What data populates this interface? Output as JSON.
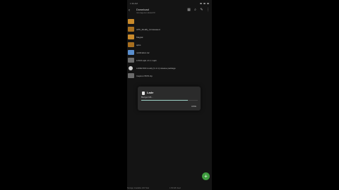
{
  "status": {
    "time": "1:39 AM"
  },
  "appbar": {
    "title": "Download",
    "subtitle": "/storage/emulated/0"
  },
  "toolbar": {
    "icons": [
      "grid-icon",
      "search-icon",
      "edit-icon",
      "more-icon"
    ]
  },
  "files": [
    {
      "name": "",
      "icon": "folder",
      "meta": ""
    },
    {
      "name": "APK_Modify_Unreleased",
      "icon": "folder-dark",
      "meta": ""
    },
    {
      "name": "Magisk",
      "icon": "folder",
      "meta": ""
    },
    {
      "name": "apks",
      "icon": "folder-dark",
      "meta": ""
    },
    {
      "name": "notification.tar",
      "icon": "file-blue",
      "meta": ""
    },
    {
      "name": "LOGS apk v1.1.1.apk",
      "icon": "file-grey",
      "meta": ""
    },
    {
      "name": "LADE FIM mostly (1.1.1) release package",
      "icon": "file-round",
      "meta": ""
    },
    {
      "name": "Inspiron 5570.zip",
      "icon": "file-grey",
      "meta": ""
    }
  ],
  "dialog": {
    "title": "Lade",
    "message": "Beriget Mit...",
    "button": "HIDE",
    "progress": 0.82
  },
  "fab": {
    "label": "+"
  },
  "footer": {
    "left": "Storage: Available 100 Total",
    "right": "1.53 GB Used"
  }
}
